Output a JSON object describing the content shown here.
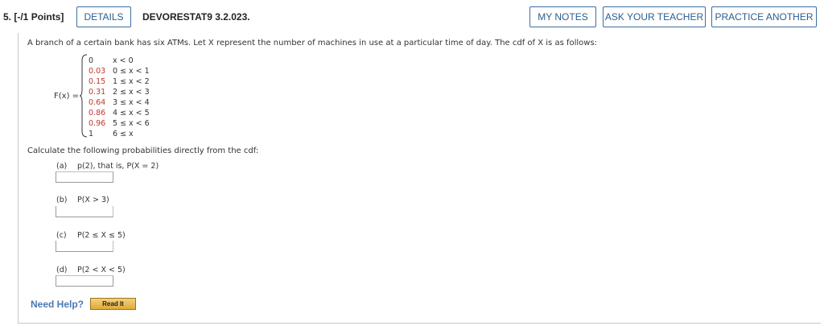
{
  "question": {
    "number": "5.",
    "points": "[-/1 Points]",
    "details_label": "DETAILS",
    "code": "DEVORESTAT9 3.2.023.",
    "my_notes_label": "MY NOTES",
    "ask_teacher_label": "ASK YOUR TEACHER",
    "practice_label": "PRACTICE ANOTHER"
  },
  "stem": "A branch of a certain bank has six ATMs. Let X represent the number of machines in use at a particular time of day. The cdf of X is as follows:",
  "cdf": {
    "label": "F(x) =",
    "rows": [
      {
        "value": "0",
        "condition": "x < 0",
        "highlight": false
      },
      {
        "value": "0.03",
        "condition": "0 ≤ x < 1",
        "highlight": true
      },
      {
        "value": "0.15",
        "condition": "1 ≤ x < 2",
        "highlight": true
      },
      {
        "value": "0.31",
        "condition": "2 ≤ x < 3",
        "highlight": true
      },
      {
        "value": "0.64",
        "condition": "3 ≤ x < 4",
        "highlight": true
      },
      {
        "value": "0.86",
        "condition": "4 ≤ x < 5",
        "highlight": true
      },
      {
        "value": "0.96",
        "condition": "5 ≤ x < 6",
        "highlight": true
      },
      {
        "value": "1",
        "condition": "6 ≤ x",
        "highlight": false
      }
    ]
  },
  "calc_prompt": "Calculate the following probabilities directly from the cdf:",
  "parts": [
    {
      "label": "(a)",
      "text": "p(2), that is, P(X = 2)"
    },
    {
      "label": "(b)",
      "text": "P(X > 3)"
    },
    {
      "label": "(c)",
      "text": "P(2 ≤ X ≤ 5)"
    },
    {
      "label": "(d)",
      "text": "P(2 < X < 5)"
    }
  ],
  "help": {
    "need_help": "Need Help?",
    "read_it": "Read It"
  },
  "colors": {
    "accent": "#2a5d91",
    "cdf_value": "#c0392b",
    "help": "#4a7ab0"
  }
}
